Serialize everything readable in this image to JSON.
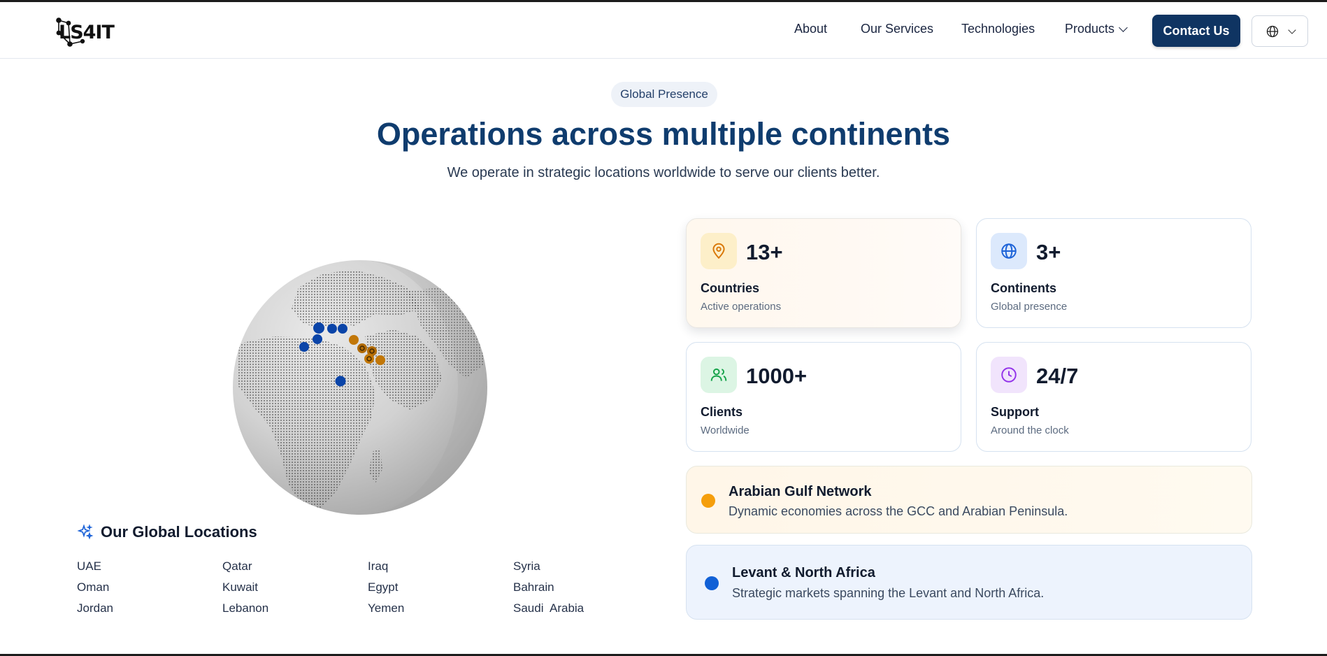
{
  "header": {
    "logo_text": "LS4IT",
    "nav": {
      "about": "About",
      "services": "Our Services",
      "technologies": "Technologies",
      "products": "Products"
    },
    "contact_label": "Contact Us",
    "language_icon": "globe-icon"
  },
  "hero": {
    "badge": "Global Presence",
    "title": "Operations across multiple continents",
    "subtitle": "We operate in strategic locations worldwide to serve our clients better."
  },
  "locations": {
    "title": "Our Global Locations",
    "icon": "sparkles-icon",
    "items": [
      "UAE",
      "Qatar",
      "Iraq",
      "Syria",
      "Oman",
      "Kuwait",
      "Egypt",
      "Bahrain",
      "Jordan",
      "Lebanon",
      "Yemen",
      "Saudi  Arabia"
    ]
  },
  "stats": [
    {
      "value": "13+",
      "label": "Countries",
      "sub": "Active operations",
      "icon": "map-pin-icon",
      "color": "#d97706",
      "bg": "#fdefc9"
    },
    {
      "value": "3+",
      "label": "Continents",
      "sub": "Global presence",
      "icon": "globe-icon",
      "color": "#1d63d8",
      "bg": "#dce9fc"
    },
    {
      "value": "1000+",
      "label": "Clients",
      "sub": "Worldwide",
      "icon": "users-icon",
      "color": "#16a34a",
      "bg": "#dcf5e4"
    },
    {
      "value": "24/7",
      "label": "Support",
      "sub": "Around the clock",
      "icon": "clock-icon",
      "color": "#9333ea",
      "bg": "#f1e4fc"
    }
  ],
  "regions": [
    {
      "title": "Arabian Gulf Network",
      "desc": "Dynamic economies across the GCC and Arabian Peninsula.",
      "color": "#f59e0b"
    },
    {
      "title": "Levant & North Africa",
      "desc": "Strategic markets spanning the Levant and North Africa.",
      "color": "#1160d6"
    }
  ],
  "colors": {
    "brand": "#0f3462",
    "headline": "#0f3c6e",
    "gulf_marker": "#f59e0b",
    "levant_marker": "#1160d6"
  }
}
